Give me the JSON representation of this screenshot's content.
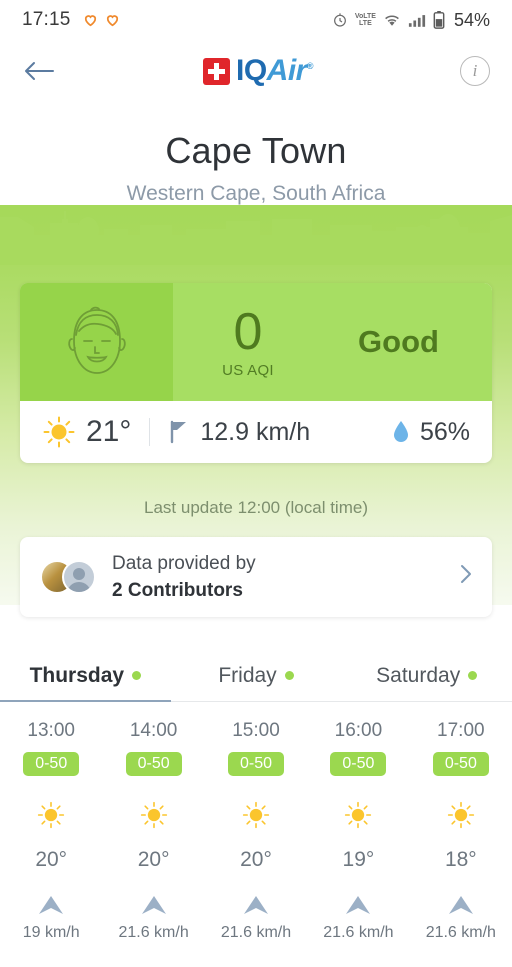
{
  "statusbar": {
    "time": "17:15",
    "battery": "54%",
    "icons": [
      "heart-icon",
      "heart-icon",
      "alarm-icon",
      "volte-icon",
      "wifi-icon",
      "signal-icon",
      "battery-icon"
    ],
    "volte_label_top": "VoLTE",
    "volte_label_bottom": "LTE"
  },
  "header": {
    "back": "back-arrow-icon",
    "logo_iq": "IQ",
    "logo_air": "Air",
    "logo_reg": "®",
    "info": "i"
  },
  "location": {
    "city": "Cape Town",
    "region": "Western Cape, South Africa"
  },
  "aqi": {
    "value": "0",
    "unit": "US AQI",
    "status": "Good",
    "face_icon": "smiling-face-icon",
    "color": "#a7de63",
    "panel_color": "#96d44a",
    "text_color": "#4f7a1f"
  },
  "weather": {
    "condition_icon": "sun-icon",
    "temperature": "21°",
    "wind_icon": "wind-flag-icon",
    "wind": "12.9 km/h",
    "humidity_icon": "water-drop-icon",
    "humidity": "56%"
  },
  "last_update": "Last update 12:00 (local time)",
  "contributors": {
    "label": "Data provided by",
    "count_label": "2 Contributors",
    "chevron": "chevron-right-icon"
  },
  "days": [
    {
      "label": "Thursday",
      "active": true
    },
    {
      "label": "Friday",
      "active": false
    },
    {
      "label": "Saturday",
      "active": false
    }
  ],
  "hourly": [
    {
      "time": "13:00",
      "aqi_range": "0-50",
      "icon": "sun-icon",
      "temp": "20°",
      "wind": "19 km/h"
    },
    {
      "time": "14:00",
      "aqi_range": "0-50",
      "icon": "sun-icon",
      "temp": "20°",
      "wind": "21.6 km/h"
    },
    {
      "time": "15:00",
      "aqi_range": "0-50",
      "icon": "sun-icon",
      "temp": "20°",
      "wind": "21.6 km/h"
    },
    {
      "time": "16:00",
      "aqi_range": "0-50",
      "icon": "sun-icon",
      "temp": "19°",
      "wind": "21.6 km/h"
    },
    {
      "time": "17:00",
      "aqi_range": "0-50",
      "icon": "sun-icon",
      "temp": "18°",
      "wind": "21.6 km/h"
    }
  ]
}
